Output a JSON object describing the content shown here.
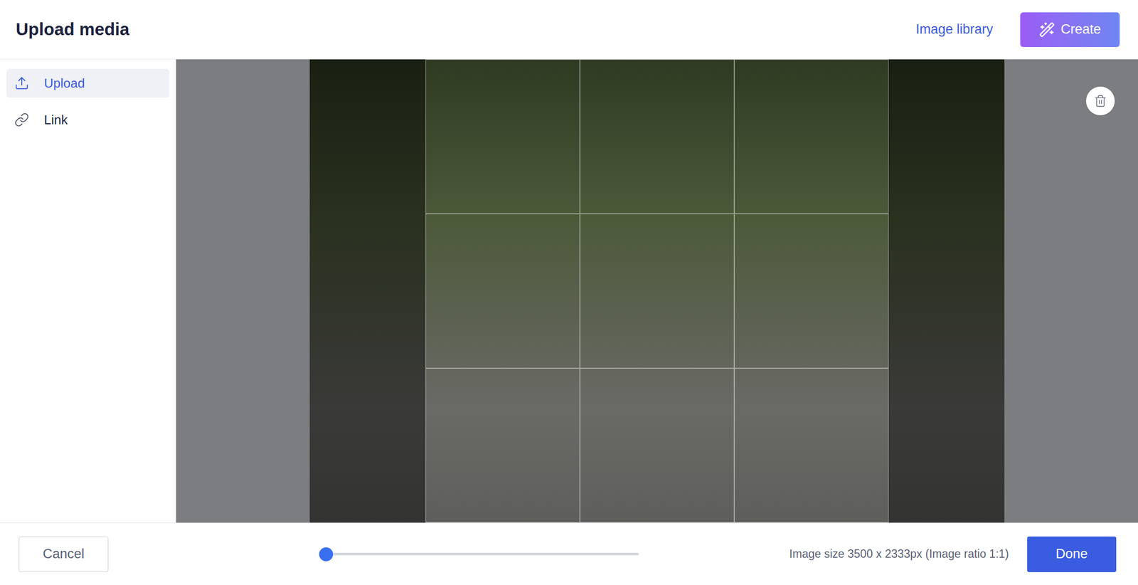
{
  "window": {
    "title": "Upload media"
  },
  "header_actions": {
    "image_library": "Image library",
    "create": "Create"
  },
  "sidebar": {
    "items": [
      {
        "label": "Upload",
        "kind": "upload",
        "selected": true
      },
      {
        "label": "Link",
        "kind": "link",
        "selected": false
      }
    ]
  },
  "zoom_slider": {
    "level": 0
  },
  "image_info": "Image size 3500 x 2333px (Image ratio 1:1)",
  "buttons": {
    "cancel": "Cancel",
    "done": "Done"
  }
}
